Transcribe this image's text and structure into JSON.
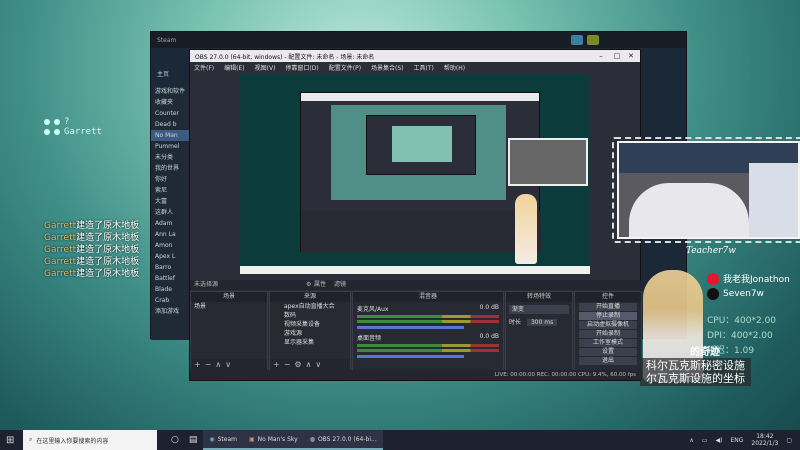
{
  "hud": {
    "players": [
      {
        "name": "?"
      },
      {
        "name": "Garrett"
      }
    ],
    "log": [
      {
        "who": "Garrett",
        "text": "建造了原木地板"
      },
      {
        "who": "Garrett",
        "text": "建造了原木地板"
      },
      {
        "who": "Garrett",
        "text": "建造了原木地板"
      },
      {
        "who": "Garrett",
        "text": "建造了原木地板"
      },
      {
        "who": "Garrett",
        "text": "建造了原木地板"
      }
    ]
  },
  "steam": {
    "title": "Steam",
    "nav_home": "主页",
    "nav_games": "游戏和软件",
    "section": "收藏夹",
    "games": [
      "Counter",
      "Dead b",
      "No Man",
      "Pummel",
      "未分类",
      "我的世界",
      "你好",
      "索尼",
      "大富",
      "这群人",
      "Adam",
      "Ann La",
      "Amon",
      "Apex L",
      "Barro",
      "Battlef",
      "Blade",
      "Crab"
    ],
    "add_game": "添加游戏"
  },
  "obs": {
    "title": "OBS 27.0.0 (64-bit, windows) - 配置文件: 未命名 - 场景: 未命名",
    "menu": [
      "文件(F)",
      "编辑(E)",
      "视图(V)",
      "停靠窗口(D)",
      "配置文件(P)",
      "场景集合(S)",
      "工具(T)",
      "帮助(H)"
    ],
    "source_bar": "未选择源",
    "source_bar_btns": [
      "属性",
      "滤镜"
    ],
    "docks": {
      "scenes": {
        "title": "场景",
        "items": [
          "场景"
        ]
      },
      "sources": {
        "title": "来源",
        "items": [
          "apex自动直播大合",
          "数码",
          "视频采集设备",
          "游戏源",
          "显示器采集"
        ]
      },
      "mixer": {
        "title": "混音器",
        "tracks": [
          {
            "name": "麦克风/Aux",
            "db": "0.0 dB"
          },
          {
            "name": "桌面音频",
            "db": "0.0 dB"
          }
        ]
      },
      "transitions": {
        "title": "转场特效",
        "type": "渐变",
        "duration_label": "时长",
        "duration": "300 ms"
      },
      "controls": {
        "title": "控件",
        "buttons": [
          "开始直播",
          "停止录制",
          "启动虚拟摄像机",
          "开始录制",
          "工作室模式",
          "设置",
          "退出"
        ]
      }
    },
    "status": "LIVE: 00:00:00   REC: 00:00:00   CPU: 9.4%, 60.00 fps"
  },
  "overlay": {
    "teacher": "Teacher7w",
    "weibo": "我老我Jonathon",
    "douyin": "Seven7w",
    "stats": [
      "CPU：400*2.00",
      "DPI：400*2.00",
      "延迟：1.09"
    ],
    "highlight": "的奇迹",
    "subtitle1": "科尔瓦克斯秘密设施",
    "subtitle2": "尔瓦克斯设施的坐标"
  },
  "taskbar": {
    "search_placeholder": "在这里输入你要搜索的内容",
    "apps": [
      {
        "label": "Steam"
      },
      {
        "label": "No Man's Sky"
      },
      {
        "label": "OBS 27.0.0 (64-bi..."
      }
    ],
    "lang": "ENG",
    "time": "18:42",
    "date": "2022/1/3"
  },
  "colors": {
    "obs_bg": "#2b2e38",
    "steam_bg": "#1b2838",
    "taskbar": "#1e2230",
    "accent_orange": "#e6b85c"
  }
}
